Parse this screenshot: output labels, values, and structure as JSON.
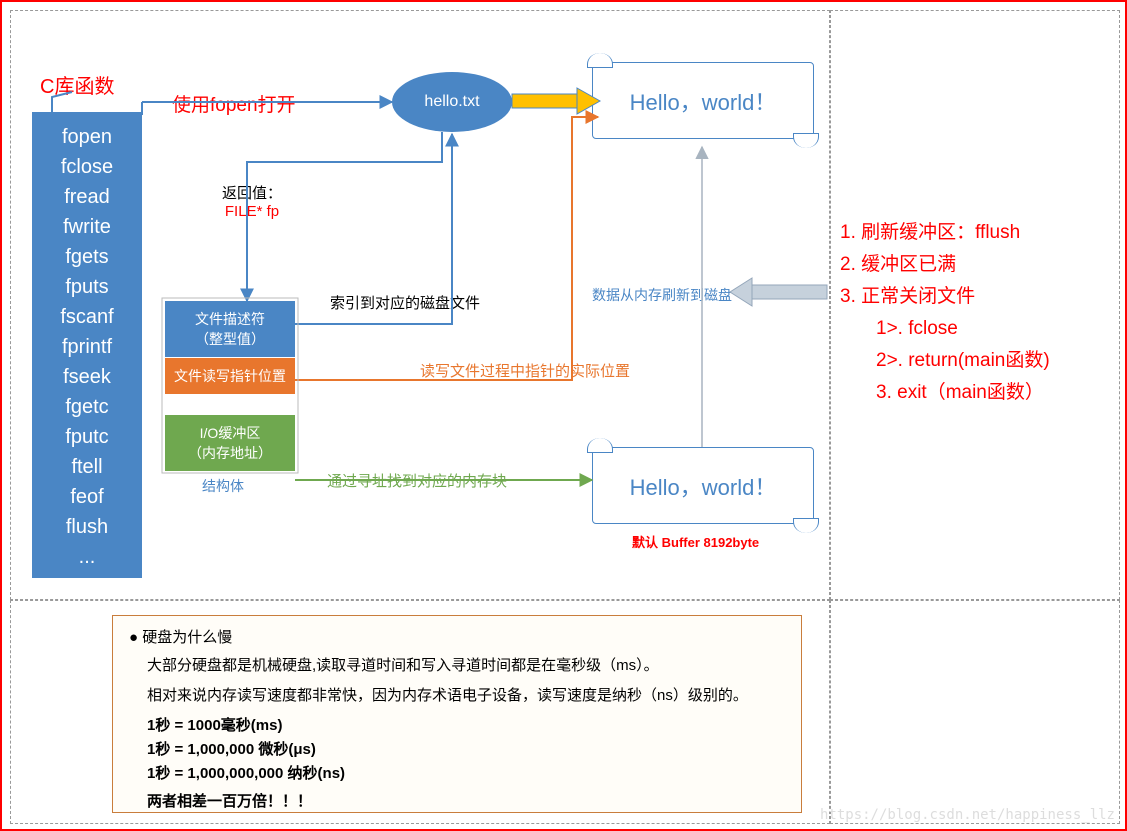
{
  "labels": {
    "c_lib": "C库函数",
    "fopen_open": "使用fopen打开",
    "file_name": "hello.txt",
    "hello_top": "Hello，world！",
    "hello_bottom": "Hello，world！",
    "return_val_1": "返回值：",
    "return_val_2": "FILE* fp",
    "index_to_disk": "索引到对应的磁盘文件",
    "rw_pointer_pos": "读写文件过程中指针的实际位置",
    "find_mem": "通过寻址找到对应的内存块",
    "flush_to_disk": "数据从内存刷新到磁盘",
    "default_buffer": "默认 Buffer 8192byte",
    "struct_label": "结构体"
  },
  "functions": [
    "fopen",
    "fclose",
    "fread",
    "fwrite",
    "fgets",
    "fputs",
    "fscanf",
    "fprintf",
    "fseek",
    "fgetc",
    "fputc",
    "ftell",
    "feof",
    "flush",
    "..."
  ],
  "struct_blocks": {
    "fd": "文件描述符\n（整型值）",
    "rw": "文件读写指针位置",
    "io": "I/O缓冲区\n（内存地址）"
  },
  "red_list": {
    "l1": "1. 刷新缓冲区：fflush",
    "l2": "2. 缓冲区已满",
    "l3": "3. 正常关闭文件",
    "s1": "1>. fclose",
    "s2": "2>. return(main函数)",
    "s3": "3. exit（main函数）"
  },
  "note": {
    "title": "硬盘为什么慢",
    "p1": "大部分硬盘都是机械硬盘,读取寻道时间和写入寻道时间都是在毫秒级（ms）。",
    "p2": "相对来说内存读写速度都非常快，因为内存术语电子设备，读写速度是纳秒（ns）级别的。",
    "t1": "1秒 = 1000毫秒(ms)",
    "t2": "1秒 = 1,000,000 微秒(μs)",
    "t3": "1秒 = 1,000,000,000 纳秒(ns)",
    "diff": "两者相差一百万倍！！！"
  },
  "watermark": "https://blog.csdn.net/happiness_llz"
}
